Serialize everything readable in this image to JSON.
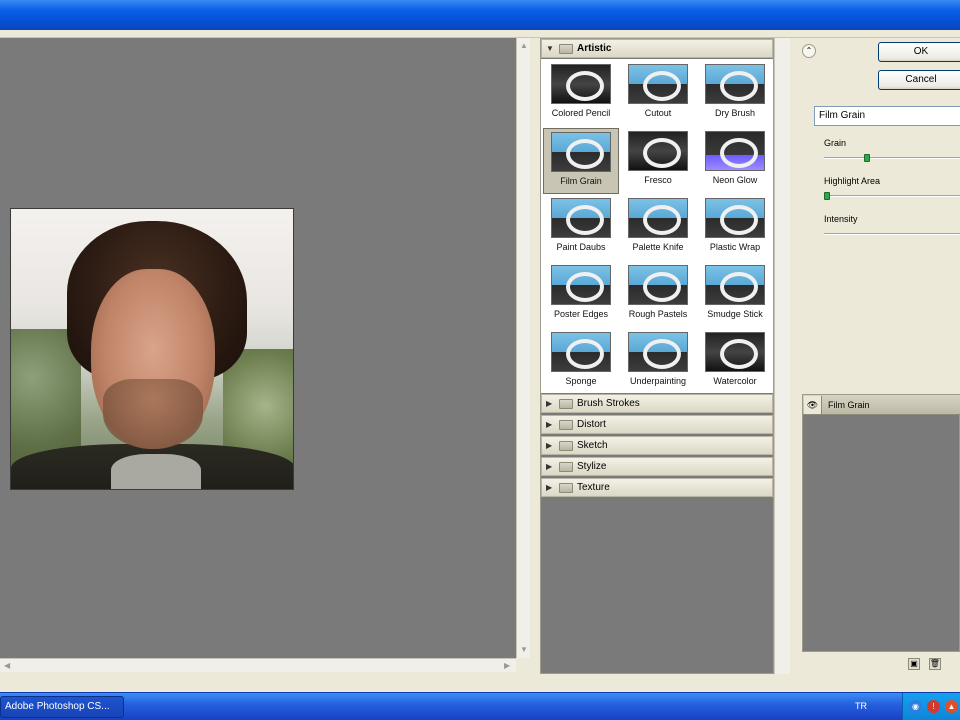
{
  "dialog": {
    "ok_label": "OK",
    "cancel_label": "Cancel"
  },
  "gallery": {
    "open_category": "Artistic",
    "artistic_filters": [
      {
        "label": "Colored Pencil",
        "style": "dark"
      },
      {
        "label": "Cutout",
        "style": "normal"
      },
      {
        "label": "Dry Brush",
        "style": "normal"
      },
      {
        "label": "Film Grain",
        "style": "normal"
      },
      {
        "label": "Fresco",
        "style": "dark"
      },
      {
        "label": "Neon Glow",
        "style": "purple"
      },
      {
        "label": "Paint Daubs",
        "style": "normal"
      },
      {
        "label": "Palette Knife",
        "style": "normal"
      },
      {
        "label": "Plastic Wrap",
        "style": "normal"
      },
      {
        "label": "Poster Edges",
        "style": "normal"
      },
      {
        "label": "Rough Pastels",
        "style": "normal"
      },
      {
        "label": "Smudge Stick",
        "style": "normal"
      },
      {
        "label": "Sponge",
        "style": "normal"
      },
      {
        "label": "Underpainting",
        "style": "normal"
      },
      {
        "label": "Watercolor",
        "style": "dark"
      }
    ],
    "selected_filter": "Film Grain",
    "collapsed_categories": [
      "Brush Strokes",
      "Distort",
      "Sketch",
      "Stylize",
      "Texture"
    ]
  },
  "settings": {
    "filter_select_value": "Film Grain",
    "params": [
      {
        "label": "Grain",
        "value": 0.3
      },
      {
        "label": "Highlight Area",
        "value": 0.0
      },
      {
        "label": "Intensity",
        "value": null
      }
    ]
  },
  "effect_layers": [
    {
      "name": "Film Grain",
      "visible": true
    }
  ],
  "taskbar": {
    "app_label": "Adobe Photoshop CS...",
    "language": "TR"
  }
}
